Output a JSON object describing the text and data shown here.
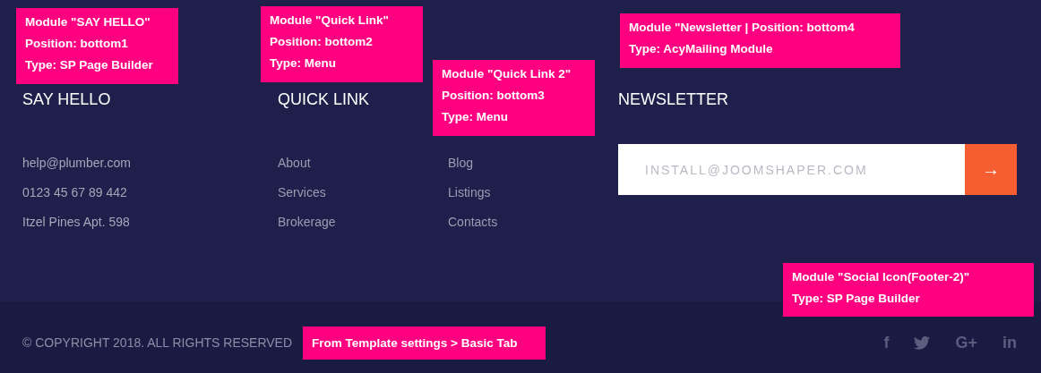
{
  "columns": [
    {
      "heading": "SAY HELLO",
      "items": [
        "help@plumber.com",
        "0123 45 67 89 442",
        "Itzel Pines Apt. 598"
      ],
      "kind": "contact"
    },
    {
      "heading": "QUICK LINK",
      "items": [
        "About",
        "Services",
        "Brokerage"
      ],
      "kind": "menu"
    },
    {
      "items": [
        "Blog",
        "Listings",
        "Contacts"
      ],
      "kind": "menu"
    }
  ],
  "newsletter": {
    "heading": "NEWSLETTER",
    "placeholder": "INSTALL@JOOMSHAPER.COM",
    "button": "→"
  },
  "copyright": "© COPYRIGHT 2018. ALL RIGHTS RESERVED",
  "social": [
    {
      "kind": "glyph",
      "glyph": "f"
    },
    {
      "kind": "bird"
    },
    {
      "kind": "glyph",
      "glyph": "G+"
    },
    {
      "kind": "glyph",
      "glyph": "in"
    }
  ],
  "annotations": [
    {
      "lines": [
        "Module \"SAY HELLO\"",
        "Position: bottom1",
        "Type: SP Page Builder"
      ]
    },
    {
      "lines": [
        "Module \"Quick Link\"",
        "Position: bottom2",
        "Type: Menu"
      ]
    },
    {
      "lines": [
        "Module \"Quick Link 2\"",
        "Position: bottom3",
        "Type: Menu"
      ]
    },
    {
      "lines": [
        "Module \"Newsletter | Position: bottom4",
        "Type: AcyMailing Module"
      ]
    },
    {
      "lines": [
        "Module \"Social Icon(Footer-2)\"",
        "Type: SP Page Builder"
      ]
    },
    {
      "lines": [
        "From Template settings > Basic Tab"
      ]
    }
  ]
}
